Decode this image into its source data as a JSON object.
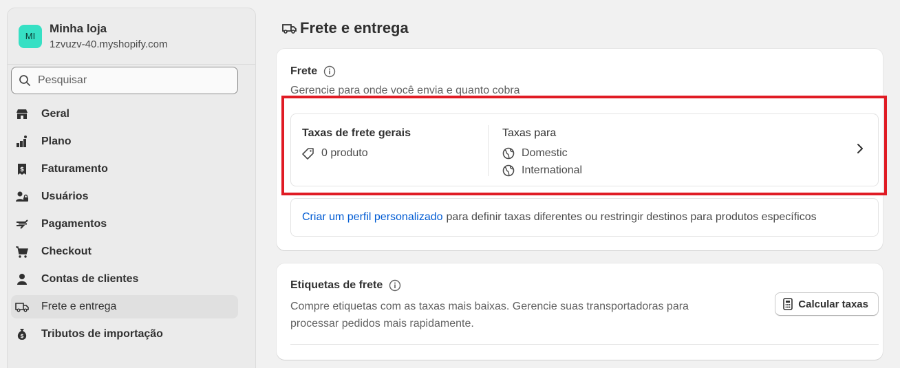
{
  "store": {
    "avatar_initials": "MI",
    "name": "Minha loja",
    "url": "1zvuzv-40.myshopify.com",
    "avatar_color": "#36e0c4"
  },
  "search": {
    "placeholder": "Pesquisar"
  },
  "sidebar": {
    "items": [
      {
        "label": "Geral",
        "icon": "store-icon"
      },
      {
        "label": "Plano",
        "icon": "plan-icon"
      },
      {
        "label": "Faturamento",
        "icon": "receipt-dollar-icon"
      },
      {
        "label": "Usuários",
        "icon": "users-icon"
      },
      {
        "label": "Pagamentos",
        "icon": "payments-hand-icon"
      },
      {
        "label": "Checkout",
        "icon": "cart-icon"
      },
      {
        "label": "Contas de clientes",
        "icon": "person-icon"
      },
      {
        "label": "Frete e entrega",
        "icon": "truck-icon",
        "active": true
      },
      {
        "label": "Tributos de importação",
        "icon": "money-bag-icon"
      }
    ]
  },
  "page": {
    "title": "Frete e entrega"
  },
  "shipping_card": {
    "title": "Frete",
    "subtitle": "Gerencie para onde você envia e quanto cobra",
    "general_rates": {
      "title": "Taxas de frete gerais",
      "products": "0 produto",
      "rates_for_label": "Taxas para",
      "zones": [
        "Domestic",
        "International"
      ]
    },
    "custom_profile": {
      "link": "Criar um perfil personalizado",
      "text": "para definir taxas diferentes ou restringir destinos para produtos específicos"
    }
  },
  "labels_card": {
    "title": "Etiquetas de frete",
    "description_line1": "Compre etiquetas com as taxas mais baixas. Gerencie suas transportadoras para",
    "description_line2": "processar pedidos mais rapidamente.",
    "button": "Calcular taxas"
  },
  "colors": {
    "link": "#005bd3",
    "highlight": "#e01b24"
  }
}
